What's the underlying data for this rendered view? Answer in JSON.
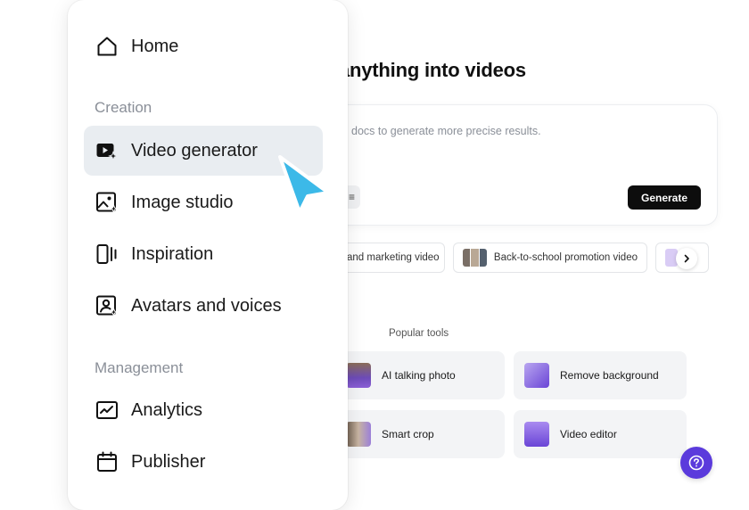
{
  "hero": {
    "title": "anything into videos"
  },
  "prompt": {
    "placeholder": "docs to generate more precise results.",
    "chip_label": "≡",
    "generate_label": "Generate"
  },
  "suggestions": [
    {
      "label": "and marketing video"
    },
    {
      "label": "Back-to-school promotion video"
    },
    {
      "label": ""
    }
  ],
  "popular_tools": {
    "title": "Popular tools",
    "items": [
      {
        "label": "AI talking photo"
      },
      {
        "label": "Remove background"
      },
      {
        "label": "Smart crop"
      },
      {
        "label": "Video editor"
      }
    ]
  },
  "sidebar": {
    "home_label": "Home",
    "groups": [
      {
        "title": "Creation",
        "items": [
          {
            "label": "Video generator",
            "icon": "video-sparkle-icon",
            "active": true
          },
          {
            "label": "Image studio",
            "icon": "image-sparkle-icon"
          },
          {
            "label": "Inspiration",
            "icon": "inspiration-icon"
          },
          {
            "label": "Avatars and voices",
            "icon": "avatar-icon"
          }
        ]
      },
      {
        "title": "Management",
        "items": [
          {
            "label": "Analytics",
            "icon": "analytics-icon"
          },
          {
            "label": "Publisher",
            "icon": "calendar-icon"
          }
        ]
      }
    ]
  },
  "colors": {
    "accent": "#5b3bdc",
    "cursor": "#3cb9e8",
    "active_item_bg": "#e9edf1",
    "generate_bg": "#0d0d0d"
  }
}
